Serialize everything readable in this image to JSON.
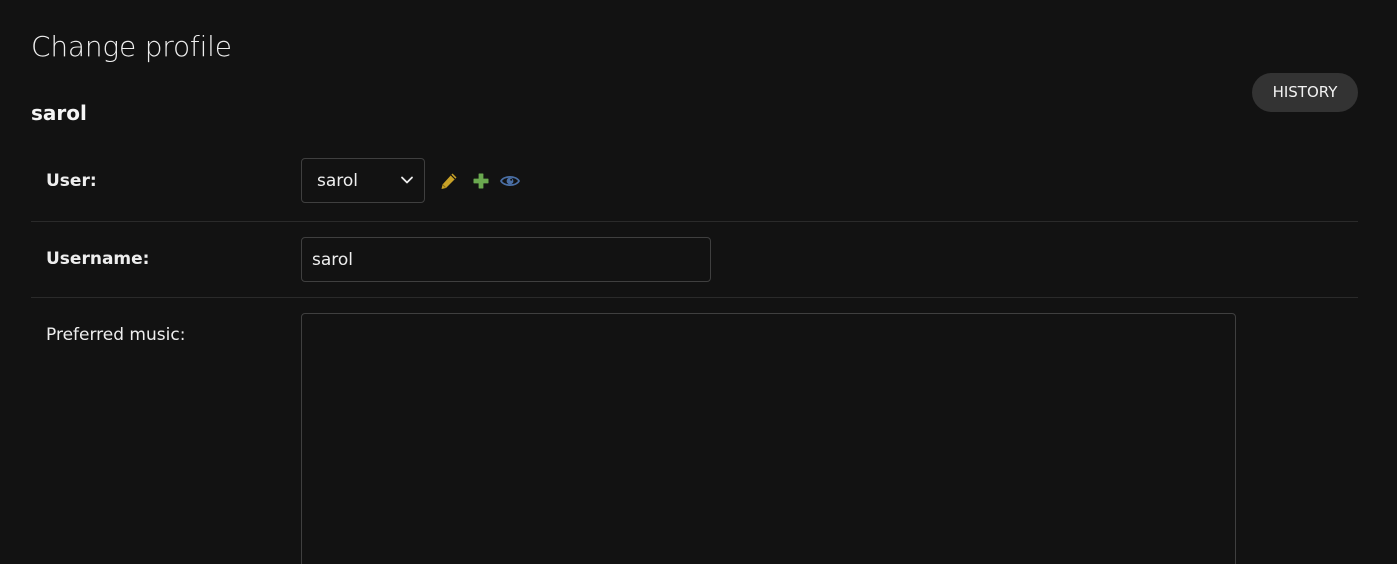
{
  "header": {
    "title": "Change profile",
    "object_name": "sarol",
    "history_label": "HISTORY"
  },
  "form": {
    "user": {
      "label": "User:",
      "selected_value": "sarol",
      "actions": [
        "pencil-icon",
        "plus-icon",
        "eye-icon"
      ]
    },
    "username": {
      "label": "Username:",
      "value": "sarol"
    },
    "preferred_music": {
      "label": "Preferred music:",
      "value": ""
    }
  },
  "colors": {
    "background": "#121212",
    "text": "#eeeeee",
    "history_button": "#333333",
    "pencil": "#c9a227",
    "plus": "#6aa84f",
    "eye": "#4a6fa5",
    "border": "#3f3f3f"
  }
}
